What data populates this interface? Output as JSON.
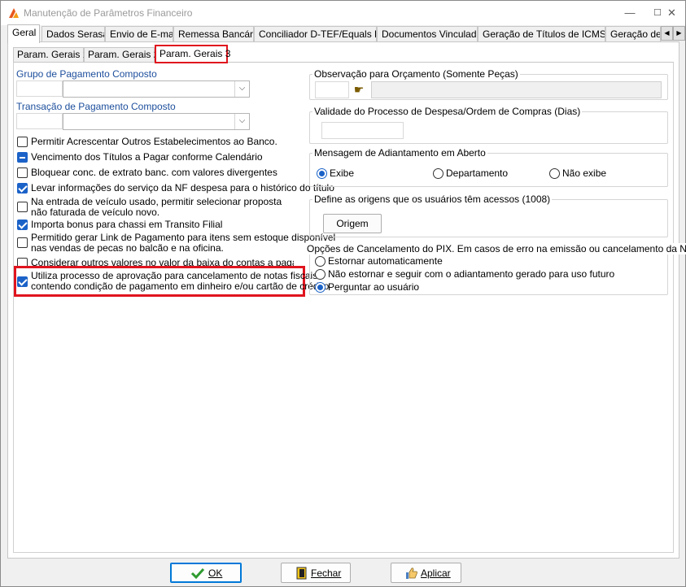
{
  "window": {
    "title": "Manutenção de Parâmetros Financeiro",
    "minimize": "—",
    "maximize": "☐",
    "close": "✕"
  },
  "tabs": [
    {
      "label": "Geral",
      "active": true
    },
    {
      "label": "Dados Serasa"
    },
    {
      "label": "Envio de E-mail"
    },
    {
      "label": "Remessa Bancária"
    },
    {
      "label": "Conciliador D-TEF/Equals Lite"
    },
    {
      "label": "Documentos Vinculados"
    },
    {
      "label": "Geração de Títulos de ICMS ST"
    },
    {
      "label": "Geração de"
    }
  ],
  "tab_scroll": {
    "left": "◀",
    "right": "▶"
  },
  "subtabs": [
    {
      "label": "Param. Gerais 1"
    },
    {
      "label": "Param. Gerais 2"
    },
    {
      "label": "Param. Gerais 3",
      "active": true
    }
  ],
  "left": {
    "grupo_label": "Grupo de Pagamento Composto",
    "transacao_label": "Transação de Pagamento Composto",
    "combo_arrow": "⌵",
    "checkboxes": [
      {
        "label": "Permitir Acrescentar Outros Estabelecimentos ao Banco.",
        "state": "off"
      },
      {
        "label": "Vencimento dos Títulos a Pagar conforme Calendário",
        "state": "indeterminate"
      },
      {
        "label": "Bloquear conc. de extrato banc. com valores divergentes",
        "state": "off"
      },
      {
        "label": "Levar informações do serviço da NF despesa para o histórico do título",
        "state": "on"
      },
      {
        "label_line1": "Na entrada de veículo usado, permitir selecionar proposta",
        "label_line2": "não faturada de veículo novo.",
        "state": "off"
      },
      {
        "label": "Importa bonus para chassi em Transito Filial",
        "state": "on"
      },
      {
        "label_line1": "Permitido gerar Link de Pagamento para itens sem estoque disponível",
        "label_line2": "nas vendas de pecas no balcão e na oficina.",
        "state": "off"
      },
      {
        "label": "Considerar outros valores no valor da baixa do contas a pagar",
        "state": "off"
      },
      {
        "label_line1": "Utiliza processo de aprovação para cancelamento de notas fiscais",
        "label_line2": "contendo condição de pagamento em dinheiro e/ou cartão de crédito",
        "state": "on"
      }
    ]
  },
  "right": {
    "observacao": {
      "title": "Observação para Orçamento (Somente Peças)",
      "lookup_icon": "☛"
    },
    "validade": {
      "title": "Validade do Processo de Despesa/Ordem de Compras (Dias)"
    },
    "mensagem": {
      "title": "Mensagem de Adiantamento em Aberto",
      "options": [
        {
          "label": "Exibe",
          "selected": true
        },
        {
          "label": "Departamento",
          "selected": false
        },
        {
          "label": "Não exibe",
          "selected": false
        }
      ]
    },
    "origens": {
      "title": "Define as origens que os usuários têm acessos (1008)",
      "button": "Origem"
    },
    "pix": {
      "title": "Opções de Cancelamento do PIX. Em casos de erro na emissão ou cancelamento da NF-e",
      "options": [
        {
          "label": "Estornar automaticamente",
          "selected": false
        },
        {
          "label": "Não estornar e seguir com o adiantamento gerado para uso futuro",
          "selected": false
        },
        {
          "label": "Perguntar ao usuário",
          "selected": true
        }
      ]
    }
  },
  "footer": {
    "ok": "OK",
    "fechar": "Fechar",
    "aplicar": "Aplicar"
  },
  "colors": {
    "accent": "#1b62c8",
    "highlight": "#e0141e",
    "label_blue": "#1c4e9c"
  }
}
